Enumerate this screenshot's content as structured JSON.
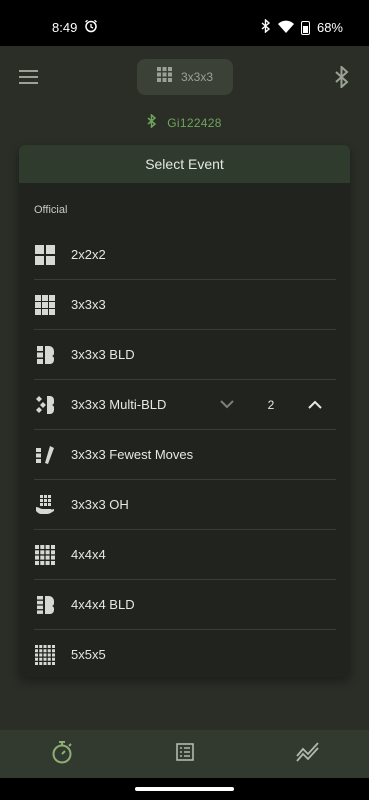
{
  "status_bar": {
    "time": "8:49",
    "battery": "68%"
  },
  "app_bar": {
    "current_event": "3x3x3"
  },
  "device": {
    "name": "Gi122428"
  },
  "dialog": {
    "title": "Select Event",
    "section": "Official",
    "items": [
      {
        "label": "2x2x2",
        "icon": "cube-2x2-icon"
      },
      {
        "label": "3x3x3",
        "icon": "cube-3x3-icon"
      },
      {
        "label": "3x3x3 BLD",
        "icon": "blindfold-icon"
      },
      {
        "label": "3x3x3 Multi-BLD",
        "icon": "multi-blindfold-icon",
        "count": "2"
      },
      {
        "label": "3x3x3 Fewest Moves",
        "icon": "pencil-icon"
      },
      {
        "label": "3x3x3 OH",
        "icon": "one-hand-icon"
      },
      {
        "label": "4x4x4",
        "icon": "cube-4x4-icon"
      },
      {
        "label": "4x4x4 BLD",
        "icon": "blindfold-icon"
      },
      {
        "label": "5x5x5",
        "icon": "cube-5x5-icon"
      }
    ]
  },
  "bottom_nav": {
    "tabs": [
      {
        "name": "timer",
        "icon": "stopwatch-icon",
        "active": true
      },
      {
        "name": "sessions",
        "icon": "list-icon",
        "active": false
      },
      {
        "name": "stats",
        "icon": "trend-icon",
        "active": false
      }
    ]
  },
  "colors": {
    "accent": "#6fa35b",
    "background": "#2a2e27",
    "dialog": "#21231f"
  }
}
